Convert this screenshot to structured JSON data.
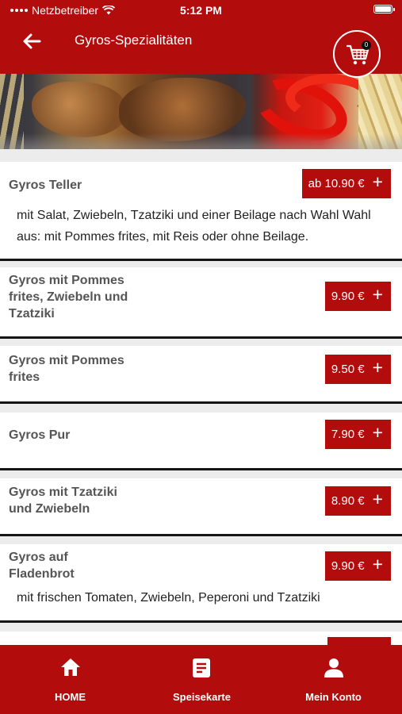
{
  "status_bar": {
    "carrier": "Netzbetreiber",
    "time": "5:12 PM"
  },
  "header": {
    "title": "Gyros-Spezialitäten",
    "cart_count": "0"
  },
  "items": [
    {
      "name": "Gyros Teller",
      "price": "ab 10.90 €",
      "description": "mit Salat, Zwiebeln, Tzatziki und einer Beilage nach Wahl Wahl aus: mit Pommes frites, mit Reis oder ohne Beilage."
    },
    {
      "name": "Gyros mit Pommes frites, Zwiebeln und Tzatziki",
      "price": "9.90 €"
    },
    {
      "name": "Gyros mit Pommes frites",
      "price": "9.50 €"
    },
    {
      "name": "Gyros Pur",
      "price": "7.90 €"
    },
    {
      "name": "Gyros mit Tzatziki und Zwiebeln",
      "price": "8.90 €"
    },
    {
      "name": "Gyros auf Fladenbrot",
      "price": "9.90 €",
      "description": "mit frischen Tomaten, Zwiebeln, Peperoni und Tzatziki"
    }
  ],
  "bottom_nav": [
    {
      "label": "HOME",
      "icon": "home-icon"
    },
    {
      "label": "Speisekarte",
      "icon": "menu-list-icon"
    },
    {
      "label": "Mein Konto",
      "icon": "user-icon"
    }
  ],
  "colors": {
    "brand": "#b30c0c",
    "text": "#555555"
  }
}
